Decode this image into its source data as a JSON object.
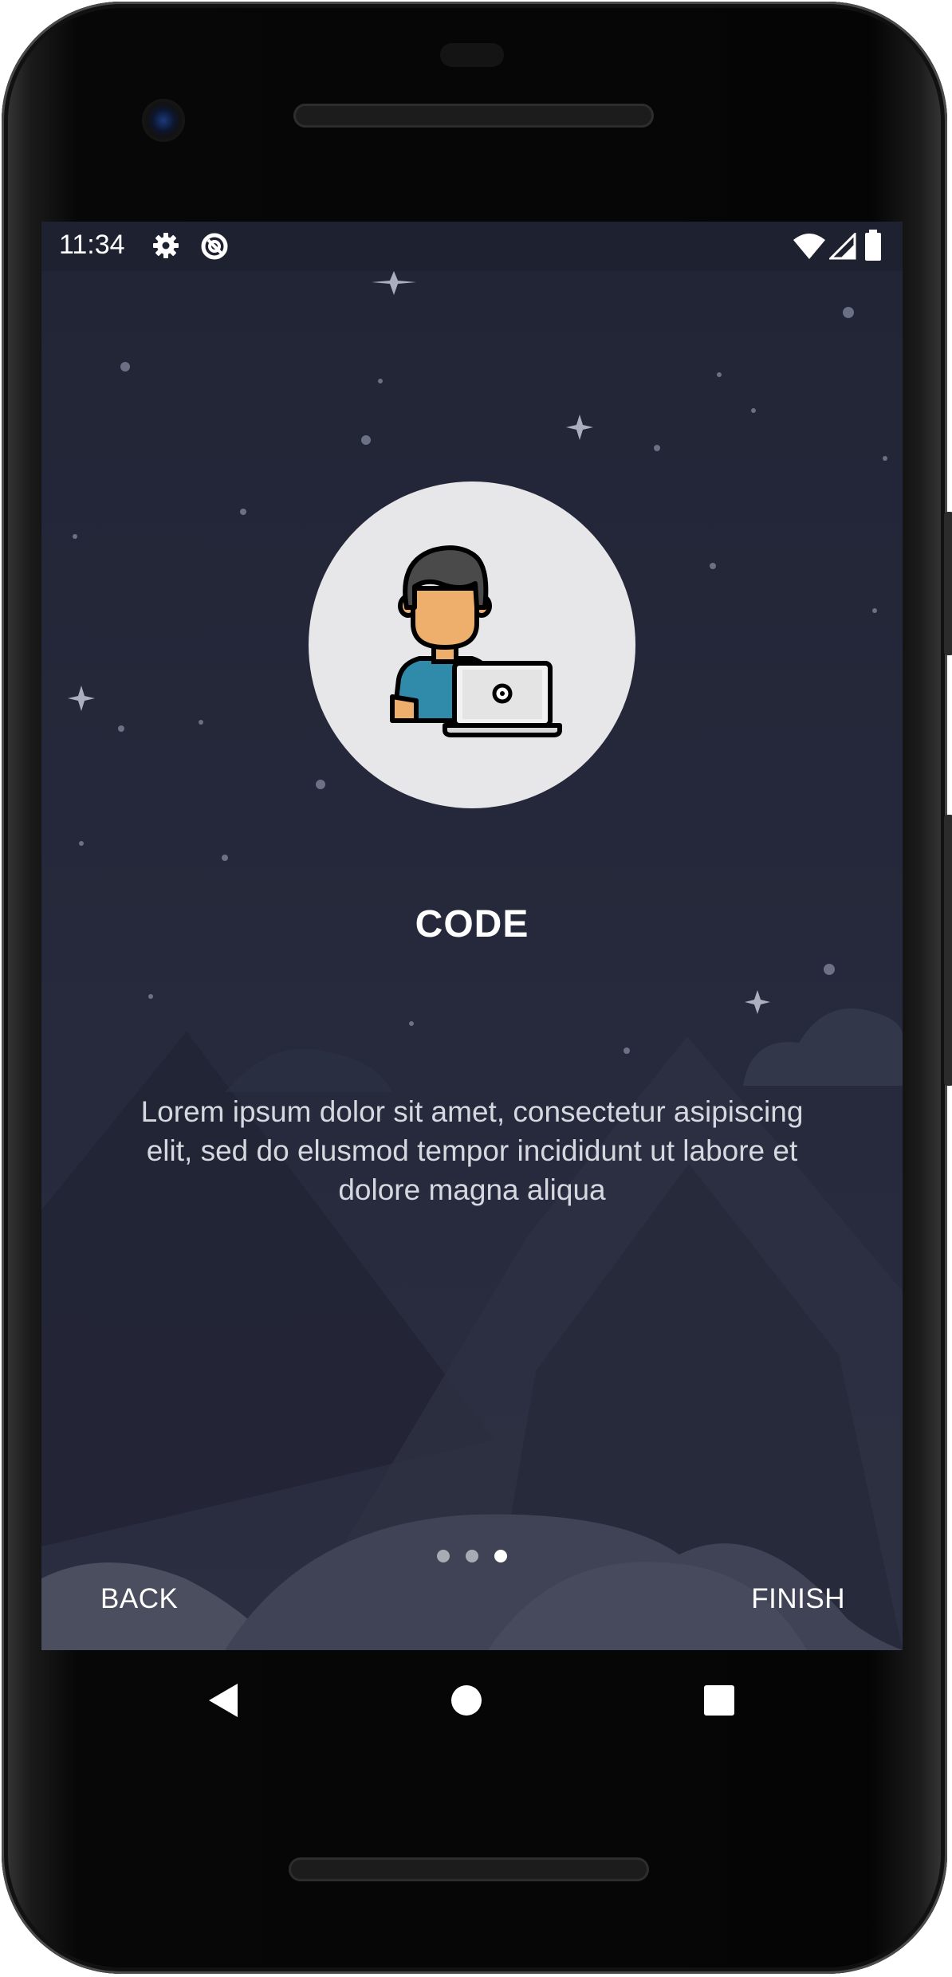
{
  "status_bar": {
    "time": "11:34",
    "icons_left": [
      "gear-icon",
      "do-not-disturb-icon"
    ],
    "icons_right": [
      "wifi-icon",
      "signal-icon",
      "battery-icon"
    ]
  },
  "onboarding": {
    "illustration": "developer-with-laptop",
    "title": "CODE",
    "description": "Lorem ipsum dolor sit amet, consectetur asipiscing elit, sed do elusmod tempor incididunt ut labore et dolore magna aliqua",
    "pager": {
      "total": 3,
      "current": 3
    },
    "back_label": "BACK",
    "finish_label": "FINISH"
  },
  "nav_bar": {
    "icons": [
      "back-triangle-icon",
      "home-circle-icon",
      "recents-square-icon"
    ]
  },
  "colors": {
    "background": "#232638",
    "status_bar": "#1e2130",
    "circle": "#e7e7ea",
    "text_primary": "#ffffff",
    "text_secondary": "#d6d8e0"
  }
}
